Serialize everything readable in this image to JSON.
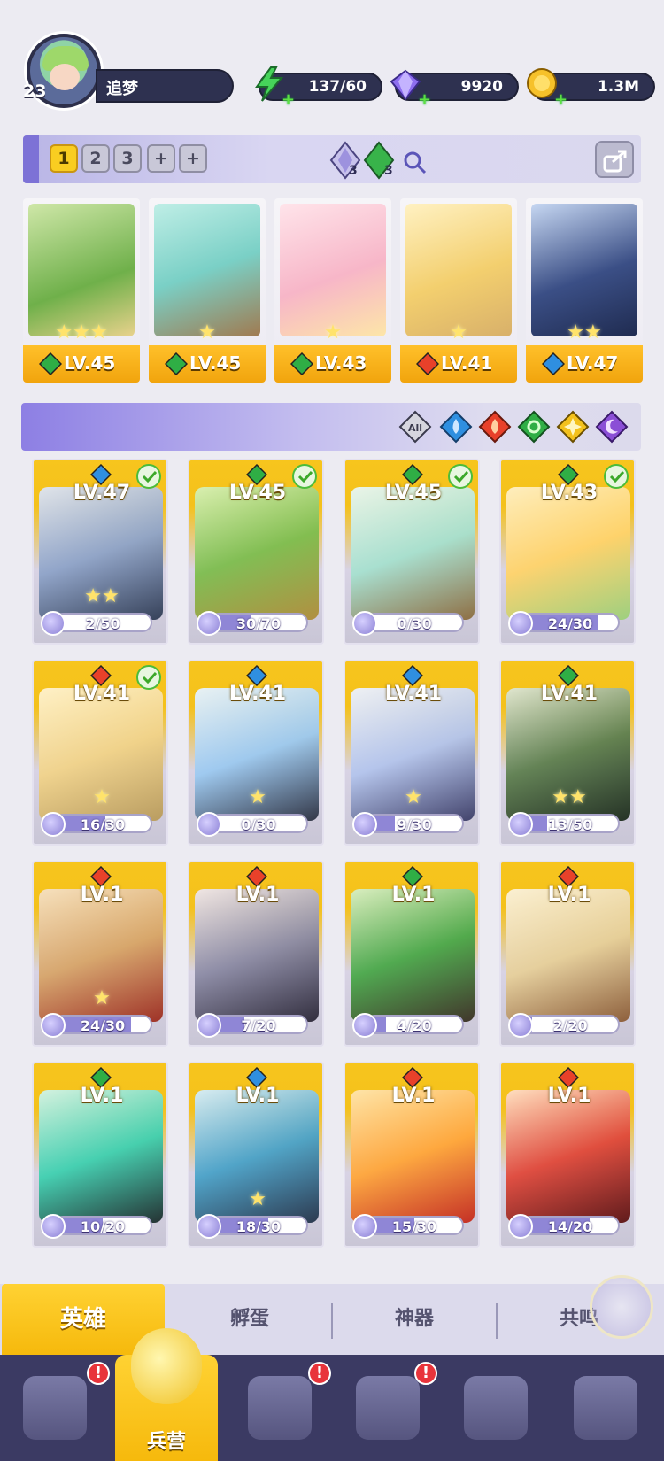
{
  "player": {
    "level": "23",
    "name": "追梦"
  },
  "resources": [
    {
      "id": "energy",
      "value": "137/60",
      "icon": "lightning-icon"
    },
    {
      "id": "gems",
      "value": "9920",
      "icon": "diamond-icon"
    },
    {
      "id": "coins",
      "value": "1.3M",
      "icon": "coin-icon"
    }
  ],
  "team": {
    "slots": [
      "1",
      "2",
      "3",
      "+",
      "+"
    ],
    "active_slot": "1",
    "element_counts": [
      "3",
      "3"
    ]
  },
  "team_heroes": [
    {
      "level": "LV.45",
      "element": "nature",
      "stars": "★★★"
    },
    {
      "level": "LV.45",
      "element": "nature",
      "stars": "★"
    },
    {
      "level": "LV.43",
      "element": "nature",
      "stars": "★"
    },
    {
      "level": "LV.41",
      "element": "fire",
      "stars": "★"
    },
    {
      "level": "LV.47",
      "element": "water",
      "stars": "★★"
    }
  ],
  "filters": [
    "All",
    "water",
    "fire",
    "nature",
    "light",
    "dark"
  ],
  "filter_all_label": "All",
  "heroes": [
    {
      "level": "LV.47",
      "element": "water",
      "shards": "2/50",
      "fill": 0.04,
      "selected": true,
      "stars": "★★"
    },
    {
      "level": "LV.45",
      "element": "nature",
      "shards": "30/70",
      "fill": 0.43,
      "selected": true,
      "stars": ""
    },
    {
      "level": "LV.45",
      "element": "nature",
      "shards": "0/30",
      "fill": 0.0,
      "selected": true,
      "stars": ""
    },
    {
      "level": "LV.43",
      "element": "nature",
      "shards": "24/30",
      "fill": 0.8,
      "selected": true,
      "stars": ""
    },
    {
      "level": "LV.41",
      "element": "fire",
      "shards": "16/30",
      "fill": 0.53,
      "selected": true,
      "stars": "★"
    },
    {
      "level": "LV.41",
      "element": "water",
      "shards": "0/30",
      "fill": 0.0,
      "selected": false,
      "stars": "★"
    },
    {
      "level": "LV.41",
      "element": "water",
      "shards": "9/30",
      "fill": 0.3,
      "selected": false,
      "stars": "★"
    },
    {
      "level": "LV.41",
      "element": "nature",
      "shards": "13/50",
      "fill": 0.26,
      "selected": false,
      "stars": "★★"
    },
    {
      "level": "LV.1",
      "element": "fire",
      "shards": "24/30",
      "fill": 0.8,
      "selected": false,
      "stars": "★"
    },
    {
      "level": "LV.1",
      "element": "fire",
      "shards": "7/20",
      "fill": 0.35,
      "selected": false,
      "stars": ""
    },
    {
      "level": "LV.1",
      "element": "nature",
      "shards": "4/20",
      "fill": 0.2,
      "selected": false,
      "stars": ""
    },
    {
      "level": "LV.1",
      "element": "fire",
      "shards": "2/20",
      "fill": 0.1,
      "selected": false,
      "stars": ""
    },
    {
      "level": "LV.1",
      "element": "nature",
      "shards": "10/20",
      "fill": 0.5,
      "selected": false,
      "stars": ""
    },
    {
      "level": "LV.1",
      "element": "water",
      "shards": "18/30",
      "fill": 0.6,
      "selected": false,
      "stars": "★"
    },
    {
      "level": "LV.1",
      "element": "fire",
      "shards": "15/30",
      "fill": 0.5,
      "selected": false,
      "stars": ""
    },
    {
      "level": "LV.1",
      "element": "fire",
      "shards": "14/20",
      "fill": 0.7,
      "selected": false,
      "stars": ""
    }
  ],
  "subtabs": [
    "英雄",
    "孵蛋",
    "神器",
    "共鸣"
  ],
  "nav": {
    "active_label": "兵营",
    "badge": "!"
  },
  "colors": {
    "water": "#2f8fe0",
    "fire": "#e8412a",
    "nature": "#2fae45",
    "light": "#f3c11c",
    "dark": "#8b4fd6",
    "accent": "#f6b90c"
  }
}
